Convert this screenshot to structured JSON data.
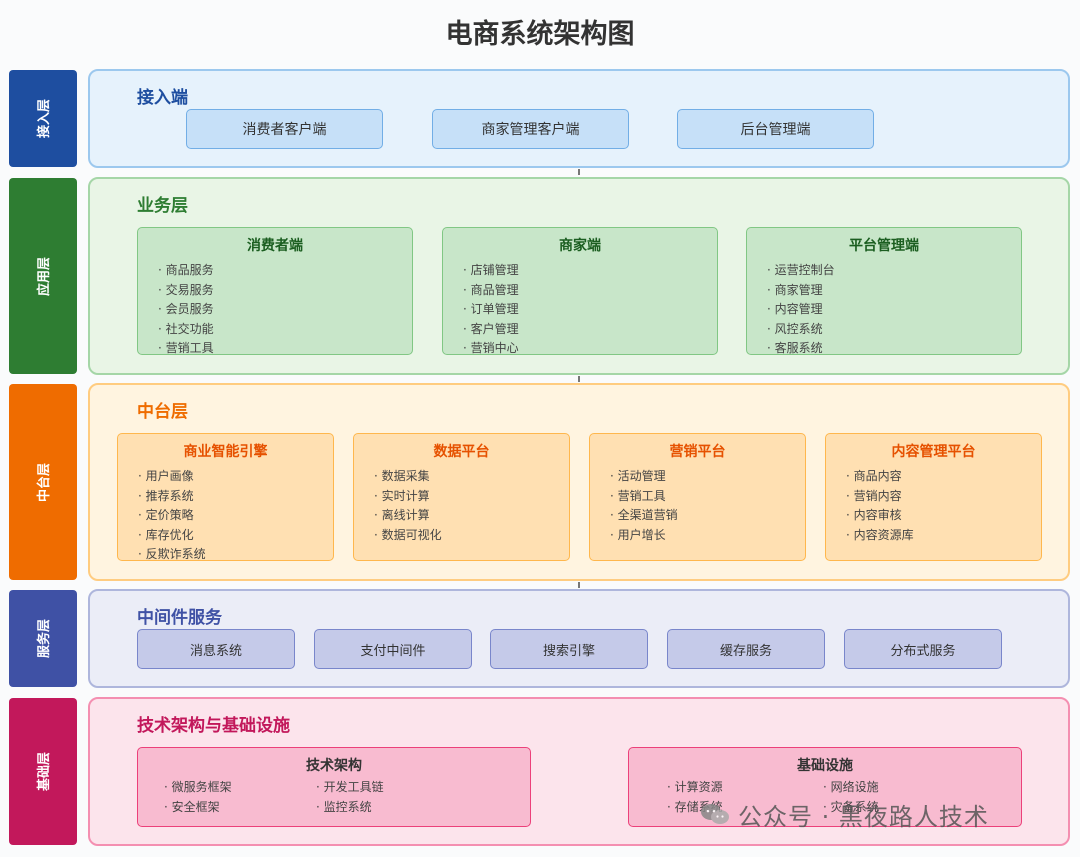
{
  "title": "电商系统架构图",
  "layers": {
    "access": {
      "side_label": "接入层",
      "section_title": "接入端",
      "chips": [
        "消费者客户端",
        "商家管理客户端",
        "后台管理端"
      ]
    },
    "application": {
      "side_label": "应用层",
      "section_title": "业务层",
      "cards": [
        {
          "title": "消费者端",
          "items": [
            "商品服务",
            "交易服务",
            "会员服务",
            "社交功能",
            "营销工具"
          ]
        },
        {
          "title": "商家端",
          "items": [
            "店铺管理",
            "商品管理",
            "订单管理",
            "客户管理",
            "营销中心"
          ]
        },
        {
          "title": "平台管理端",
          "items": [
            "运营控制台",
            "商家管理",
            "内容管理",
            "风控系统",
            "客服系统"
          ]
        }
      ]
    },
    "middle": {
      "side_label": "中台层",
      "section_title": "中台层",
      "cards": [
        {
          "title": "商业智能引擎",
          "items": [
            "用户画像",
            "推荐系统",
            "定价策略",
            "库存优化",
            "反欺诈系统"
          ]
        },
        {
          "title": "数据平台",
          "items": [
            "数据采集",
            "实时计算",
            "离线计算",
            "数据可视化"
          ]
        },
        {
          "title": "营销平台",
          "items": [
            "活动管理",
            "营销工具",
            "全渠道营销",
            "用户增长"
          ]
        },
        {
          "title": "内容管理平台",
          "items": [
            "商品内容",
            "营销内容",
            "内容审核",
            "内容资源库"
          ]
        }
      ]
    },
    "service": {
      "side_label": "服务层",
      "section_title": "中间件服务",
      "chips": [
        "消息系统",
        "支付中间件",
        "搜索引擎",
        "缓存服务",
        "分布式服务"
      ]
    },
    "base": {
      "side_label": "基础层",
      "section_title": "技术架构与基础设施",
      "cards": [
        {
          "title": "技术架构",
          "items": [
            "微服务框架",
            "开发工具链",
            "安全框架",
            "监控系统"
          ]
        },
        {
          "title": "基础设施",
          "items": [
            "计算资源",
            "网络设施",
            "存储系统",
            "灾备系统"
          ]
        }
      ]
    }
  },
  "watermark": "公众号 · 黑夜路人技术",
  "colors": {
    "access": "#1e4ea0",
    "application": "#2e7d32",
    "middle": "#ef6c00",
    "service": "#3f51a5",
    "base": "#c2185b"
  }
}
